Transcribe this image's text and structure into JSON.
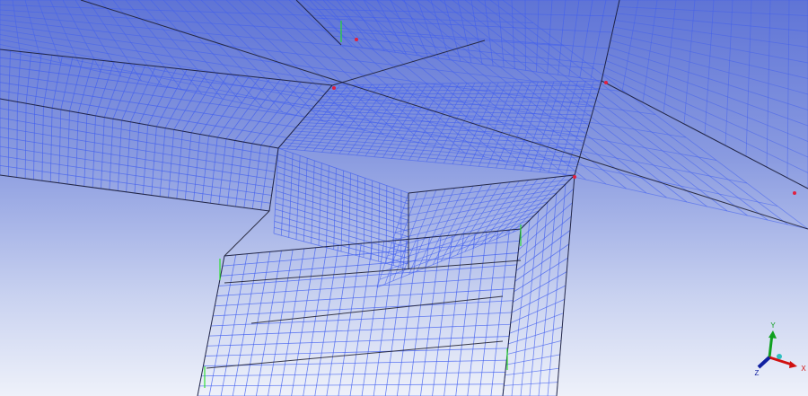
{
  "viewport": {
    "title": "Mesh view"
  },
  "triad": {
    "x_label": "X",
    "y_label": "Y",
    "z_label": "Z"
  },
  "colors": {
    "mesh": "#3e5cf0",
    "edge": "#1a1a2a",
    "x_axis": "#d01010",
    "y_axis": "#10a020",
    "z_axis": "#1020a0",
    "vertex_green": "#20e020",
    "vertex_red": "#e02040"
  }
}
